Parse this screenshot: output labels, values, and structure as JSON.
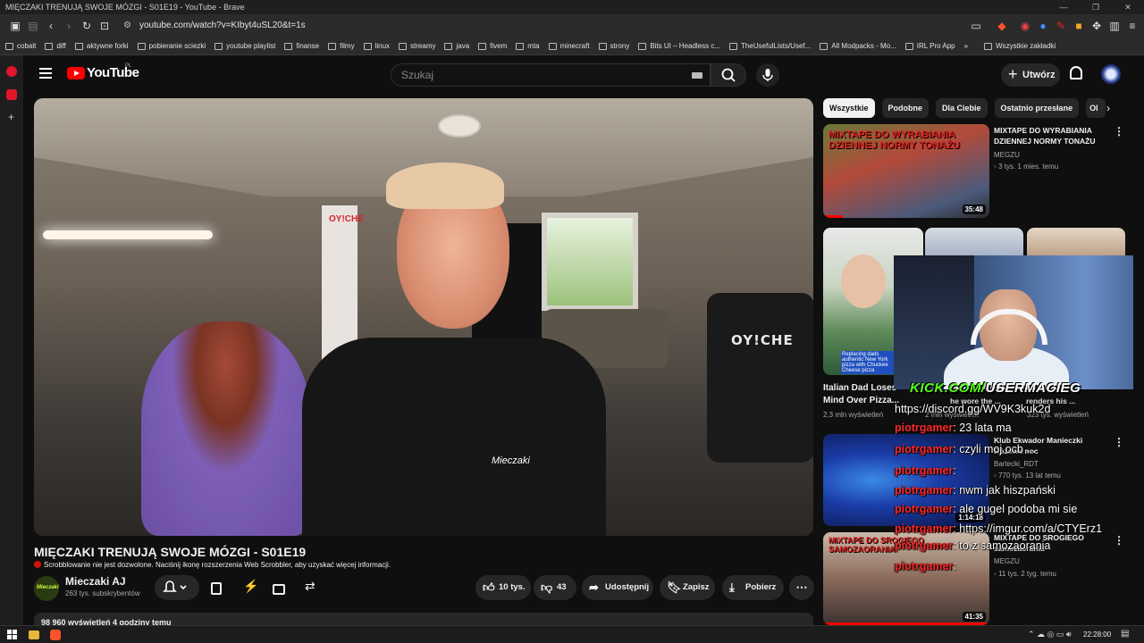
{
  "window": {
    "title": "MIĘCZAKI TRENUJĄ SWOJE MÓZGI - S01E19 - YouTube - Brave",
    "minimize": "—",
    "maximize": "❐",
    "close": "✕"
  },
  "browser": {
    "url": "youtube.com/watch?v=KIbyt4uSL20&t=1s"
  },
  "bookmarks": [
    "cobalt",
    "diff",
    "aktywne forki",
    "pobieranie sciezki",
    "youtube playlist",
    "finanse",
    "filmy",
    "linux",
    "streamy",
    "java",
    "fivem",
    "mta",
    "minecraft",
    "strony",
    "Bits UI – Headless c...",
    "TheUsefulLists/Usef...",
    "All Modpacks - Mo...",
    "IRL Pro App"
  ],
  "bookmarks_overflow": "»",
  "bookmarks_all": "Wszystkie zakładki",
  "youtube": {
    "logo_text": "YouTube",
    "country": "PL",
    "search_placeholder": "Szukaj",
    "create_label": "Utwórz"
  },
  "video": {
    "title": "MIĘCZAKI TRENUJĄ SWOJE MÓZGI - S01E19",
    "scrobble_notice": "Scrobblowanie nie jest dozwolone. Naciśnij ikonę rozszerzenia Web Scrobbler, aby uzyskać więcej informacji.",
    "channel_name": "Mieczaki AJ",
    "subscribers": "263 tys. subskrybentów",
    "likes": "10 tys.",
    "dislikes": "43",
    "share": "Udostępnij",
    "save": "Zapisz",
    "download": "Pobierz",
    "views_line": "98 960 wyświetleń  4 godziny temu",
    "wall_text": "OY!CHE",
    "logo_mark": "Mieczaki"
  },
  "chips": [
    "Wszystkie",
    "Podobne",
    "Dla Ciebie",
    "Ostatnio przesłane",
    "Ol"
  ],
  "recommendations": [
    {
      "title_line1": "MIXTAPE DO WYRABIANIA",
      "title_line2": "DZIENNEJ NORMY TONAŻU",
      "channel": "MEGZU",
      "meta": "3 tys.  1 mies. temu",
      "duration": "35:48",
      "thumb_text": "MIXTAPE DO WYRABIANIA DZIENNEJ NORMY TONAŻU"
    },
    {
      "title_line1": "Italian Dad Loses",
      "title_line2": "Mind Over Pizza...",
      "meta": "2,3 mln wyświetleń",
      "thumb_caption": "Replacing dads authentic New York pizza with Chuckee Cheese pizza"
    },
    {
      "title_line1": "Klub Ekwador Manieczki",
      "title_line2": "Różowa noc",
      "channel": "Bartecki_RDT",
      "meta": "770 tys.  13 lat temu",
      "duration": "1:14:18"
    },
    {
      "title_line1": "MIXTAPE DO SROGIEGO",
      "title_line2": "samozaorania",
      "channel": "MEGZU",
      "meta": "11 tys.  2 tyg. temu",
      "duration": "41:35",
      "thumb_text": "MIXTAPE DO SROGIEGO SAMOZAORANIA"
    }
  ],
  "stream_overlay": {
    "kick_prefix": "KICK.COM/",
    "kick_user": "USERMACIEG",
    "chat": [
      {
        "user": "",
        "text": "https://discord.gg/WV9K3kuk2d"
      },
      {
        "user": "piotrgamer",
        "text": ": 23 lata ma"
      },
      {
        "user": "piotrgamer",
        "text": ": czyli moj ocb ... "
      },
      {
        "user": "piotrgamer",
        "text": ": "
      },
      {
        "user": "piotrgamer",
        "text": ": nwm jak hiszpański"
      },
      {
        "user": "piotrgamer",
        "text": ": ale gugel podoba mi sie"
      },
      {
        "user": "piotrgamer",
        "text": ": https://imgur.com/a/CTYErz1"
      },
      {
        "user": "piotrgamer",
        "text": ": to z samozaorania"
      },
      {
        "user": "piotrgamer",
        "text": ": "
      }
    ],
    "behind_fragments": [
      "he wore the ...",
      "renders his ...",
      "2 mln wyświetleń",
      "323 tys. wyświetleń"
    ]
  },
  "taskbar": {
    "clock": "22:28:00",
    "icons": [
      "windows-icon",
      "folder-icon",
      "brave-icon"
    ]
  },
  "colors": {
    "youtube_red": "#ff0000",
    "kick_green": "#53fc18",
    "chat_user": "#ff2a2a",
    "background": "#0f0f0f"
  }
}
